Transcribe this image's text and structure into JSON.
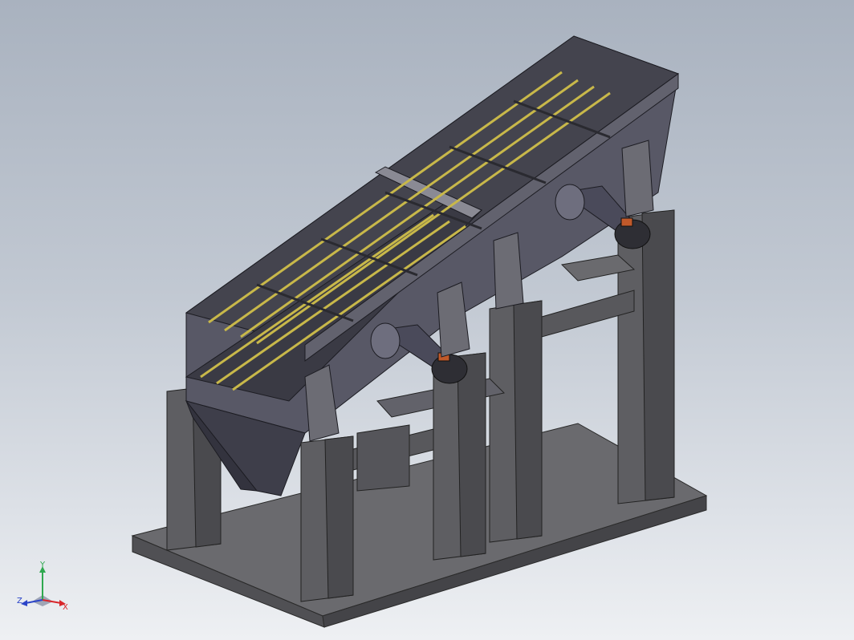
{
  "viewport": {
    "background_top": "#a9b2bf",
    "background_bottom": "#eef0f3"
  },
  "model": {
    "description_icon": "vibrating-screen-assembly-icon",
    "colors": {
      "body": "#5a5a66",
      "body_dark": "#3c3c46",
      "frame": "#66666a",
      "frame_dark": "#4a4a4e",
      "mesh_bar": "#c8b84a",
      "motor_cap": "#c0592a"
    }
  },
  "triad": {
    "x_label": "X",
    "y_label": "Y",
    "z_label": "Z",
    "x_color": "#d8262b",
    "y_color": "#2fa84f",
    "z_color": "#2b44c8"
  }
}
